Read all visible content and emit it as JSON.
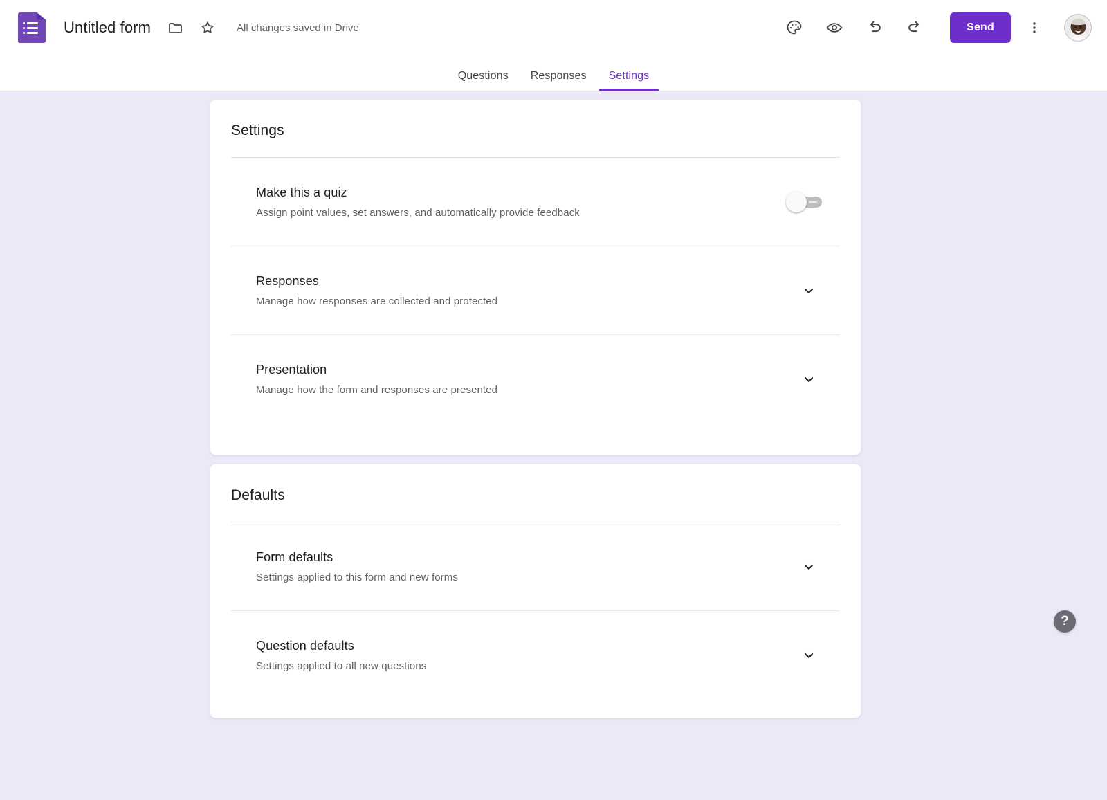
{
  "appbar": {
    "logo_icon": "google-forms-icon",
    "title": "Untitled form",
    "move_icon": "folder-icon",
    "star_icon": "star-outline-icon",
    "save_status": "All changes saved in Drive",
    "theme_icon": "palette-icon",
    "preview_icon": "eye-preview-icon",
    "undo_icon": "undo-icon",
    "redo_icon": "redo-icon",
    "send_label": "Send",
    "more_icon": "more-vert-icon",
    "avatar_icon": "user-avatar",
    "accent_color": "#6d2ec9"
  },
  "tabs": [
    {
      "label": "Questions",
      "active": false
    },
    {
      "label": "Responses",
      "active": false
    },
    {
      "label": "Settings",
      "active": true
    }
  ],
  "settings_card": {
    "title": "Settings",
    "rows": [
      {
        "label": "Make this a quiz",
        "desc": "Assign point values, set answers, and automatically provide feedback",
        "control": "toggle",
        "toggle_on": false
      },
      {
        "label": "Responses",
        "desc": "Manage how responses are collected and protected",
        "control": "chevron",
        "chevron_icon": "chevron-down-icon"
      },
      {
        "label": "Presentation",
        "desc": "Manage how the form and responses are presented",
        "control": "chevron",
        "chevron_icon": "chevron-down-icon"
      }
    ]
  },
  "defaults_card": {
    "title": "Defaults",
    "rows": [
      {
        "label": "Form defaults",
        "desc": "Settings applied to this form and new forms",
        "control": "chevron",
        "chevron_icon": "chevron-down-icon"
      },
      {
        "label": "Question defaults",
        "desc": "Settings applied to all new questions",
        "control": "chevron",
        "chevron_icon": "chevron-down-icon"
      }
    ]
  },
  "help": {
    "label": "?",
    "icon": "help-question-icon"
  },
  "colors": {
    "background": "#ece8f7",
    "card": "#ffffff",
    "accent": "#6d2ec9",
    "primary_text": "#202124",
    "secondary_text": "#5f6368"
  }
}
